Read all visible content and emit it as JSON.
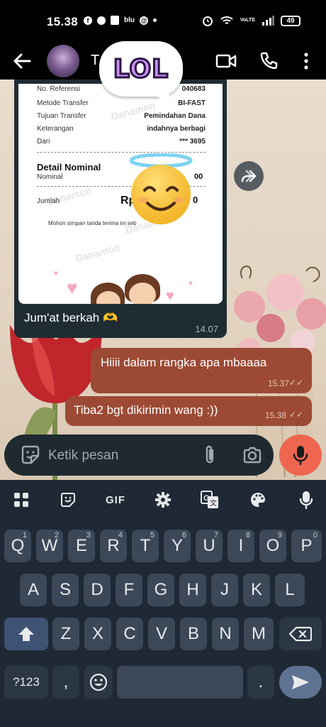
{
  "status_bar": {
    "time": "15.38",
    "network_text": "blu",
    "wifi_label": "VoLTE",
    "battery": "49"
  },
  "app_bar": {
    "contact_name": "T"
  },
  "sticker": {
    "text": "LOL"
  },
  "receipt": {
    "rows": [
      {
        "label": "No. Referensi",
        "value": "040683"
      },
      {
        "label": "Metode Transfer",
        "value": "BI-FAST"
      },
      {
        "label": "Tujuan Transfer",
        "value": "Pemindahan Dana"
      },
      {
        "label": "Keterangan",
        "value": "indahnya berbagi"
      },
      {
        "label": "Dari",
        "value": "*** 3695"
      }
    ],
    "detail_title": "Detail Nominal",
    "nominal_label": "Nominal",
    "nominal_value": "00",
    "total_label": "Jumlah",
    "total_prefix": "Rp",
    "total_suffix": "0",
    "footer": "Mohon simpan tanda terima ini seb",
    "watermark": "Danamon"
  },
  "messages": {
    "incoming_caption": "Jum'at berkah 🫶",
    "incoming_time": "14.07",
    "out1_text": "Hiiii dalam rangka apa mbaaaa",
    "out1_time": "15.37",
    "out2_text": "Tiba2 bgt dikirimin wang :))",
    "out2_time": "15.38",
    "read_ticks": "✓✓"
  },
  "input": {
    "placeholder": "Ketik pesan"
  },
  "keyboard": {
    "toolbar_gif": "GIF",
    "row1": [
      {
        "k": "Q",
        "n": "1"
      },
      {
        "k": "W",
        "n": "2"
      },
      {
        "k": "E",
        "n": "3"
      },
      {
        "k": "R",
        "n": "4"
      },
      {
        "k": "T",
        "n": "5"
      },
      {
        "k": "Y",
        "n": "6"
      },
      {
        "k": "U",
        "n": "7"
      },
      {
        "k": "I",
        "n": "8"
      },
      {
        "k": "O",
        "n": "9"
      },
      {
        "k": "P",
        "n": "0"
      }
    ],
    "row2": [
      "A",
      "S",
      "D",
      "F",
      "G",
      "H",
      "J",
      "K",
      "L"
    ],
    "row3": [
      "Z",
      "X",
      "C",
      "V",
      "B",
      "N",
      "M"
    ],
    "symbols_key": "?123",
    "comma_key": ",",
    "period_key": "."
  },
  "colors": {
    "outgoing_bubble": "#9c4a35",
    "incoming_bubble": "#1f2c34",
    "mic_button": "#ef6650",
    "keyboard_bg": "#1f2935"
  }
}
